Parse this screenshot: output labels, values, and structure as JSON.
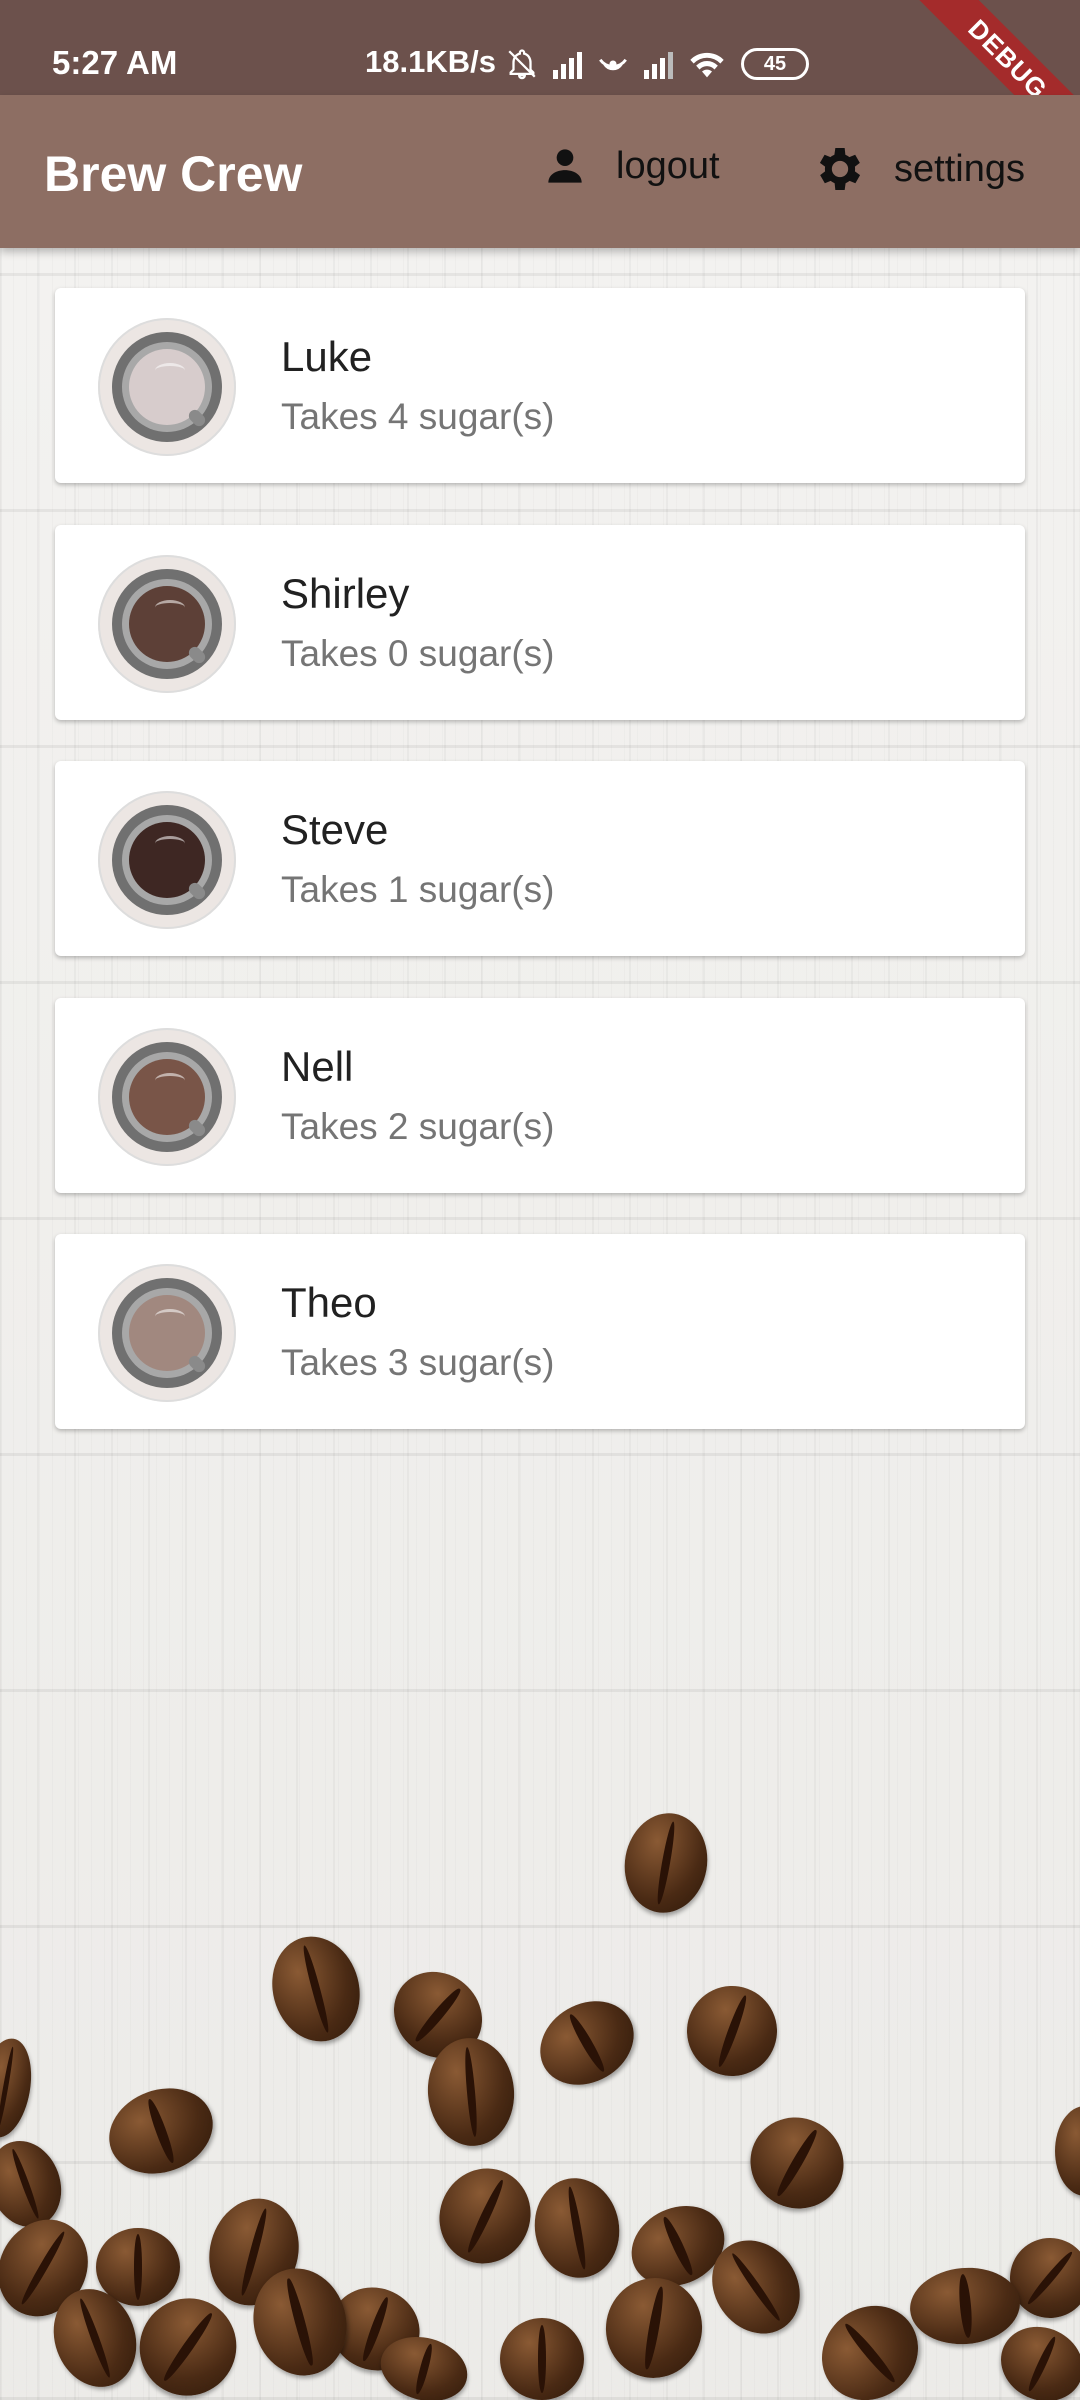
{
  "status_bar": {
    "time": "5:27 AM",
    "net_speed": "18.1KB/s",
    "battery": "45",
    "debug_label": "DEBUG"
  },
  "app_bar": {
    "title": "Brew Crew",
    "logout_label": "logout",
    "settings_label": "settings",
    "color": "#8d6e63"
  },
  "brews": [
    {
      "name": "Luke",
      "sugars_text": "Takes 4 sugar(s)",
      "coffee_color": "#d7cccc"
    },
    {
      "name": "Shirley",
      "sugars_text": "Takes 0 sugar(s)",
      "coffee_color": "#5d4037"
    },
    {
      "name": "Steve",
      "sugars_text": "Takes 1 sugar(s)",
      "coffee_color": "#3e2723"
    },
    {
      "name": "Nell",
      "sugars_text": "Takes 2 sugar(s)",
      "coffee_color": "#795548"
    },
    {
      "name": "Theo",
      "sugars_text": "Takes 3 sugar(s)",
      "coffee_color": "#a1887f"
    }
  ]
}
